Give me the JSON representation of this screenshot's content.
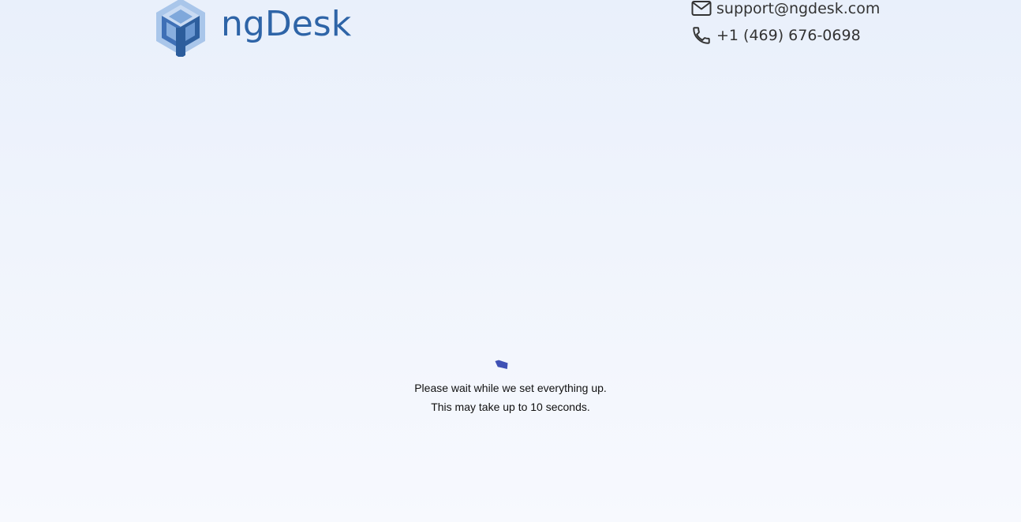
{
  "header": {
    "logo": {
      "text": "ngDesk",
      "icon": "cube-logo-icon",
      "color": "#2e64a7"
    },
    "contact": {
      "email": "support@ngdesk.com",
      "email_icon": "mail-icon",
      "phone": "+1 (469) 676-0698",
      "phone_icon": "phone-icon"
    }
  },
  "loading": {
    "spinner_icon": "spinner-icon",
    "spinner_color": "#3f51b5",
    "message_line1": "Please wait while we set everything up.",
    "message_line2": "This may take up to 10 seconds."
  }
}
